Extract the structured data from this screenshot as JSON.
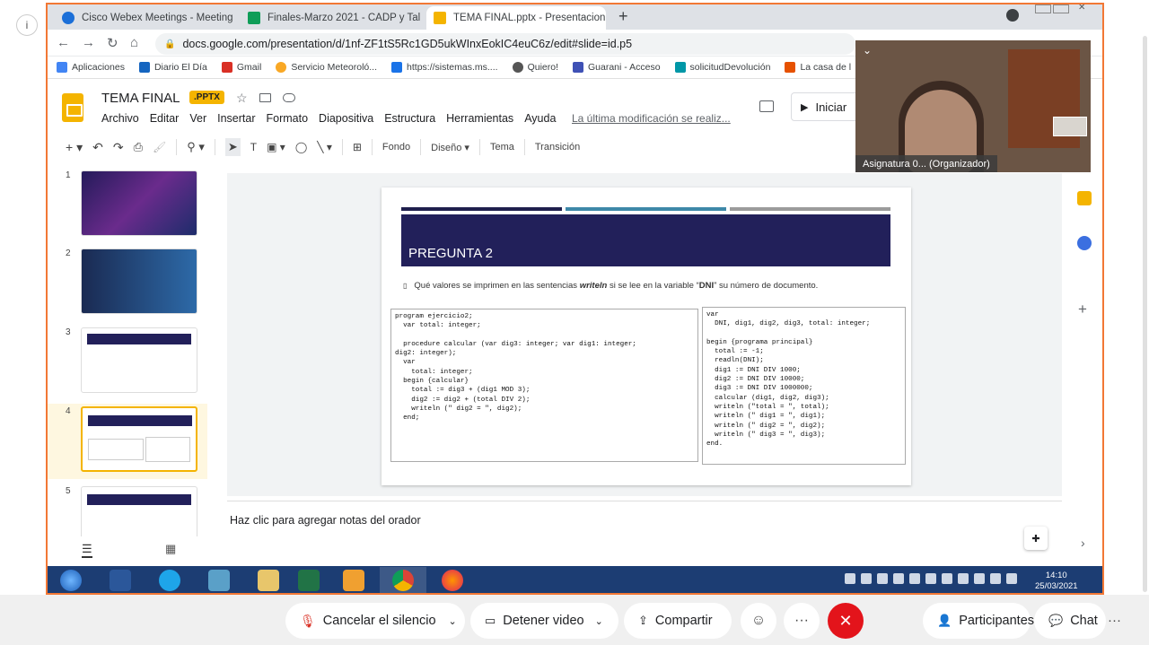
{
  "browser": {
    "tabs": [
      {
        "label": "Cisco Webex Meetings - Meeting",
        "color": "#1b6fd8"
      },
      {
        "label": "Finales-Marzo 2021 - CADP y Tal",
        "color": "#0f9d58"
      },
      {
        "label": "TEMA FINAL.pptx - Presentacion",
        "color": "#f4b400"
      }
    ],
    "url": "docs.google.com/presentation/d/1nf-ZF1tS5Rc1GD5ukWInxEokIC4euC6z/edit#slide=id.p5",
    "bookmarks": [
      {
        "label": "Aplicaciones",
        "color": "#4285f4"
      },
      {
        "label": "Diario El Día",
        "color": "#1565c0"
      },
      {
        "label": "Gmail",
        "color": "#d93025"
      },
      {
        "label": "Servicio Meteoroló...",
        "color": "#f9a825"
      },
      {
        "label": "https://sistemas.ms....",
        "color": "#1a73e8"
      },
      {
        "label": "Quiero!",
        "color": "#555555"
      },
      {
        "label": "Guarani - Acceso",
        "color": "#3f51b5"
      },
      {
        "label": "solicitudDevolución",
        "color": "#0097a7"
      },
      {
        "label": "La casa de l",
        "color": "#e65100"
      }
    ]
  },
  "docs": {
    "title": "TEMA FINAL",
    "badge": ".PPTX",
    "menus": [
      "Archivo",
      "Editar",
      "Ver",
      "Insertar",
      "Formato",
      "Diapositiva",
      "Estructura",
      "Herramientas",
      "Ayuda"
    ],
    "last_edit": "La última modificación se realiz...",
    "present_label": "Iniciar",
    "toolbar": {
      "fondo": "Fondo",
      "diseno": "Diseño",
      "tema": "Tema",
      "transicion": "Transición"
    },
    "notes_placeholder": "Haz clic para agregar notas del orador"
  },
  "filmstrip": [
    {
      "num": "1"
    },
    {
      "num": "2"
    },
    {
      "num": "3"
    },
    {
      "num": "4"
    },
    {
      "num": "5"
    }
  ],
  "slide": {
    "title": "PREGUNTA 2",
    "question_pre": "Qué valores se imprimen en las sentencias ",
    "question_em": "writeln",
    "question_mid": " si se lee en la variable “",
    "question_var": "DNI",
    "question_post": "” su número de documento.",
    "code_left": "program ejercicio2;\n  var total: integer;\n\n  procedure calcular (var dig3: integer; var dig1: integer;\ndig2: integer);\n  var\n    total: integer;\n  begin {calcular}\n    total := dig3 + (dig1 MOD 3);\n    dig2 := dig2 + (total DIV 2);\n    writeln (\" dig2 = \", dig2);\n  end;",
    "code_right": "var\n  DNI, dig1, dig2, dig3, total: integer;\n\nbegin {programa principal}\n  total := -1;\n  readln(DNI);\n  dig1 := DNI DIV 1000;\n  dig2 := DNI DIV 10000;\n  dig3 := DNI DIV 1000000;\n  calcular (dig1, dig2, dig3);\n  writeln (\"total = \", total);\n  writeln (\" dig1 = \", dig1);\n  writeln (\" dig2 = \", dig2);\n  writeln (\" dig3 = \", dig3);\nend."
  },
  "video": {
    "caption": "Asignatura 0... (Organizador)"
  },
  "taskbar": {
    "time": "14:10",
    "date": "25/03/2021"
  },
  "webex": {
    "mute": "Cancelar el silencio",
    "video": "Detener video",
    "share": "Compartir",
    "participants": "Participantes",
    "chat": "Chat"
  }
}
